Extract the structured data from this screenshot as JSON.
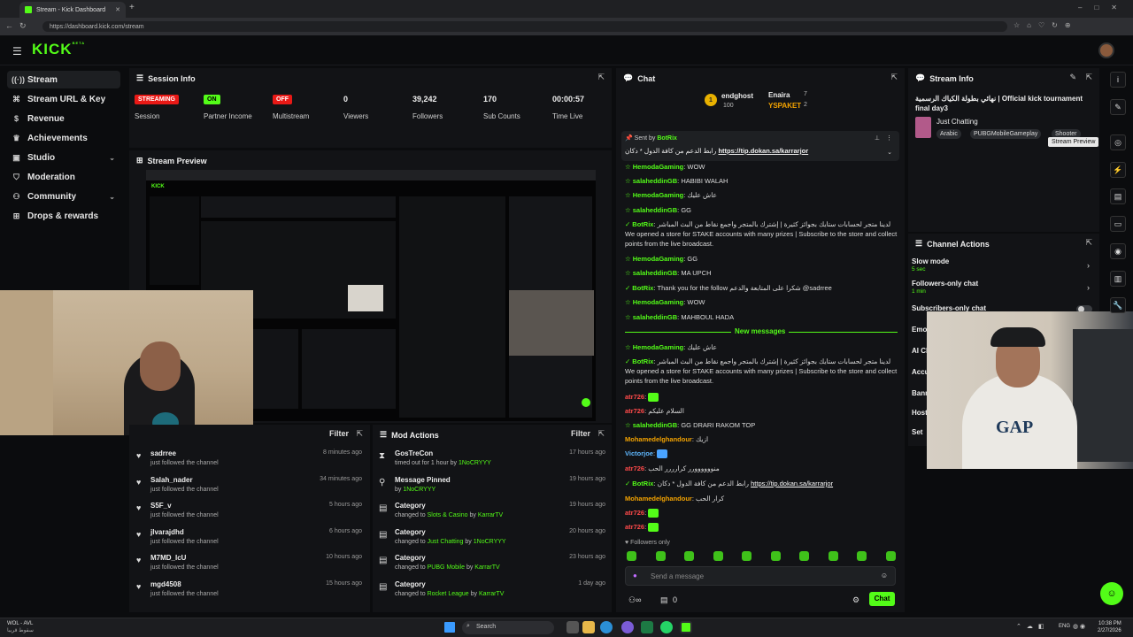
{
  "browser": {
    "tab_title": "Stream - Kick Dashboard",
    "url": "https://dashboard.kick.com/stream"
  },
  "header": {
    "logo": "KICK",
    "logo_sup": "BETA"
  },
  "sidebar": {
    "items": [
      {
        "label": "Stream",
        "icon": "signal-icon"
      },
      {
        "label": "Stream URL & Key",
        "icon": "key-icon"
      },
      {
        "label": "Revenue",
        "icon": "dollar-icon"
      },
      {
        "label": "Achievements",
        "icon": "trophy-icon"
      },
      {
        "label": "Studio",
        "icon": "studio-icon"
      },
      {
        "label": "Moderation",
        "icon": "shield-icon"
      },
      {
        "label": "Community",
        "icon": "people-icon"
      },
      {
        "label": "Drops & rewards",
        "icon": "gift-icon"
      }
    ]
  },
  "session": {
    "title": "Session Info",
    "stats": [
      {
        "badge": "STREAMING",
        "label": "Session"
      },
      {
        "badge": "ON",
        "label": "Partner Income"
      },
      {
        "badge": "OFF",
        "label": "Multistream"
      },
      {
        "value": "0",
        "label": "Viewers"
      },
      {
        "value": "39,242",
        "label": "Followers"
      },
      {
        "value": "170",
        "label": "Sub Counts"
      },
      {
        "value": "00:00:57",
        "label": "Time Live"
      }
    ]
  },
  "preview": {
    "title": "Stream Preview"
  },
  "activity": {
    "filter": "Filter",
    "items": [
      {
        "name": "sadrree",
        "sub": "just followed the channel",
        "time": "8 minutes ago"
      },
      {
        "name": "Salah_nader",
        "sub": "just followed the channel",
        "time": "34 minutes ago"
      },
      {
        "name": "S5F_v",
        "sub": "just followed the channel",
        "time": "5 hours ago"
      },
      {
        "name": "jlvarajdhd",
        "sub": "just followed the channel",
        "time": "6 hours ago"
      },
      {
        "name": "M7MD_IcU",
        "sub": "just followed the channel",
        "time": "10 hours ago"
      },
      {
        "name": "mgd4508",
        "sub": "just followed the channel",
        "time": "15 hours ago"
      }
    ]
  },
  "mod": {
    "title": "Mod Actions",
    "filter": "Filter",
    "items": [
      {
        "name": "GosTreCon",
        "sub": "timed out for 1 hour by ",
        "by": "1NoCRYYY",
        "time": "17 hours ago",
        "icon": "hourglass-icon"
      },
      {
        "name": "Message Pinned",
        "sub": "by ",
        "by": "1NoCRYYY",
        "time": "19 hours ago",
        "icon": "pin-icon"
      },
      {
        "name": "Category",
        "sub": "changed to ",
        "to": "Slots & Casino",
        "mid": " by ",
        "by": "KarrarTV",
        "time": "19 hours ago",
        "icon": "category-icon"
      },
      {
        "name": "Category",
        "sub": "changed to ",
        "to": "Just Chatting",
        "mid": " by ",
        "by": "1NoCRYYY",
        "time": "20 hours ago",
        "icon": "category-icon"
      },
      {
        "name": "Category",
        "sub": "changed to ",
        "to": "PUBG Mobile",
        "mid": " by ",
        "by": "KarrarTV",
        "time": "23 hours ago",
        "icon": "category-icon"
      },
      {
        "name": "Category",
        "sub": "changed to ",
        "to": "Rocket League",
        "mid": " by ",
        "by": "KarrarTV",
        "time": "1 day ago",
        "icon": "category-icon"
      }
    ]
  },
  "chat": {
    "title": "Chat",
    "top_gifter": "endghost",
    "top_gifter_count": "100",
    "leaders": [
      {
        "name": "Enaira",
        "count": "7"
      },
      {
        "name": "YSPAKET",
        "count": "2"
      }
    ],
    "pinned_by": "Sent by",
    "pinned_user": "BotRix",
    "pinned_text": "رابط الدعم من كافة الدول * دكان",
    "pinned_link": "https://tip.dokan.sa/karrarjor",
    "new_messages": "New messages",
    "followers_only": "Followers only",
    "placeholder": "Send a message",
    "send": "Chat",
    "viewer_count": "0",
    "messages": [
      {
        "user": "HemodaGaming",
        "text": "WOW"
      },
      {
        "user": "salaheddinGB",
        "text": "HABIBI WALAH"
      },
      {
        "user": "HemodaGaming",
        "text": "عاش عليك"
      },
      {
        "user": "salaheddinGB",
        "text": "GG"
      },
      {
        "user": "BotRix",
        "text": "لدينا متجر لحسابات ستايك بجوائز كثيرة | إشترك بالمتجر واجمع نقاط من البث المباشر We opened a store for STAKE accounts with many prizes | Subscribe to the store and collect points from the live broadcast."
      },
      {
        "user": "HemodaGaming",
        "text": "GG"
      },
      {
        "user": "salaheddinGB",
        "text": "MA UPCH"
      },
      {
        "user": "BotRix",
        "text": "Thank you for the follow شكرا على المتابعة والدعم @sadrree"
      },
      {
        "user": "HemodaGaming",
        "text": "WOW"
      },
      {
        "user": "salaheddinGB",
        "text": "MAHBOUL HADA"
      },
      {
        "user": "HemodaGaming",
        "text": "عاش عليك"
      },
      {
        "user": "BotRix",
        "text": "لدينا متجر لحسابات ستايك بجوائز كثيرة | إشترك بالمتجر واجمع نقاط من البث المباشر We opened a store for STAKE accounts with many prizes | Subscribe to the store and collect points from the live broadcast."
      },
      {
        "user": "atr726",
        "text": ""
      },
      {
        "user": "atr726",
        "text": "السلام عليكم"
      },
      {
        "user": "salaheddinGB",
        "text": "GG DRARI RAKOM TOP"
      },
      {
        "user": "Mohamedelghandour",
        "text": "ازيك"
      },
      {
        "user": "Victorjoe",
        "text": ""
      },
      {
        "user": "atr726",
        "text": "منوووووورر كرارررر الحب"
      },
      {
        "user": "BotRix",
        "text": "رابط الدعم من كافة الدول * دكان",
        "link": "https://tip.dokan.sa/karrarjor"
      },
      {
        "user": "Mohamedelghandour",
        "text": "كرار الحب"
      },
      {
        "user": "atr726",
        "text": ""
      },
      {
        "user": "atr726",
        "text": ""
      }
    ]
  },
  "stream_info": {
    "title": "Stream Info",
    "stream_title": "نهائي بطولة الكياك الرسمية | Official kick tournament final day3",
    "category": "Just Chatting",
    "tags": [
      "Arabic",
      "PUBGMobileGameplay",
      "Shooter"
    ],
    "tooltip": "Stream Preview"
  },
  "channel_actions": {
    "title": "Channel Actions",
    "items": [
      {
        "label": "Slow mode",
        "sub": "5 sec"
      },
      {
        "label": "Followers-only chat",
        "sub": "1 min"
      },
      {
        "label": "Subscribers-only chat",
        "sub": ""
      },
      {
        "label": "Emo",
        "sub": ""
      },
      {
        "label": "AI Cl",
        "sub": ""
      },
      {
        "label": "Accu",
        "sub": ""
      },
      {
        "label": "Bann",
        "sub": ""
      },
      {
        "label": "Host",
        "sub": ""
      },
      {
        "label": "Set",
        "sub": ""
      }
    ]
  },
  "taskbar": {
    "weather_label": "WOL - AVL",
    "weather_sub": "سقوط قريبا",
    "search": "Search",
    "lang": "ENG",
    "time": "10:38 PM",
    "date": "2/27/2026"
  },
  "colors": {
    "accent": "#53fc18",
    "live_red": "#e91916",
    "panel": "#121316",
    "bg": "#0b0c0e"
  }
}
